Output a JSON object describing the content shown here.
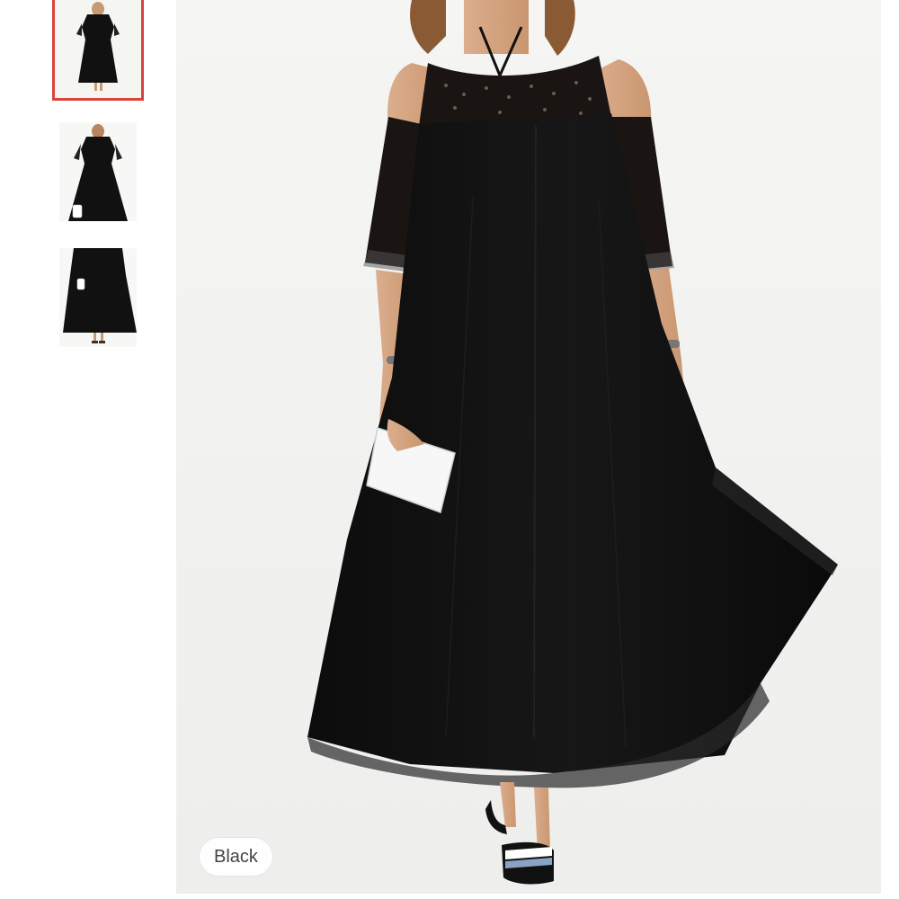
{
  "gallery": {
    "thumbnails": [
      {
        "name": "front-view",
        "selected": true
      },
      {
        "name": "front-view-clutch",
        "selected": false
      },
      {
        "name": "full-length-view",
        "selected": false
      }
    ],
    "selected_color": "Black",
    "accent_color": "#d9443a"
  }
}
